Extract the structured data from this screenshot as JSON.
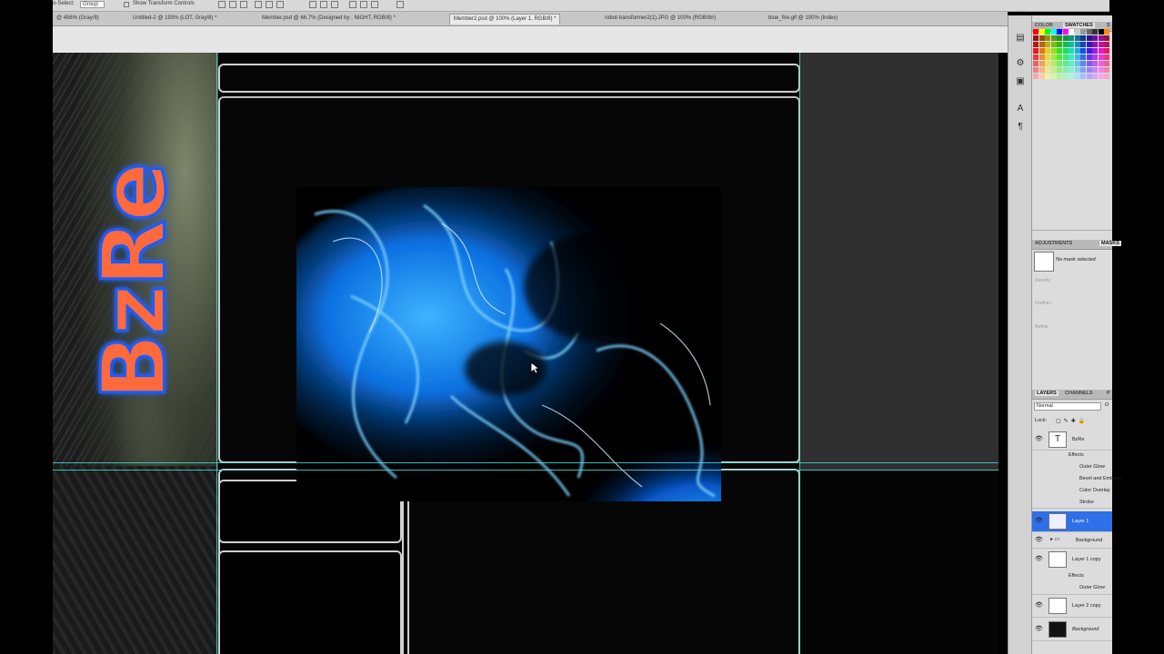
{
  "options_bar": {
    "auto_select_label": "o-Select:",
    "auto_select_value": "Group",
    "show_transform_controls": "Show Transform Controls"
  },
  "tabs": [
    {
      "label": "@ 456% (Gray/8)",
      "active": false
    },
    {
      "label": "Untitled-2 @ 193% (LOT, Gray/8) *",
      "active": false
    },
    {
      "label": "Member.psd @ 66.7% (Designed by . NIGHT, RGB/8) *",
      "active": false
    },
    {
      "label": "Member2.psd @ 100% (Layer 1, RGB/8) *",
      "active": true
    },
    {
      "label": "robot-transformer2(1).JPG @ 100% (RGB/8#)",
      "active": false
    },
    {
      "label": "blue_fire.gif @ 100% (Index)",
      "active": false
    }
  ],
  "canvas": {
    "logo_text": "BzRe"
  },
  "color_panel": {
    "tab_color": "COLOR",
    "tab_swatches": "SWATCHES",
    "tab_styles": "S"
  },
  "masks_panel": {
    "tab_adjustments": "ADJUSTMENTS",
    "tab_masks": "MASKS",
    "no_mask": "No mask selected",
    "density": "Density:",
    "feather": "Feather:",
    "refine": "Refine:"
  },
  "layers_panel": {
    "tab_layers": "LAYERS",
    "tab_channels": "CHANNELS",
    "tab_paths": "P",
    "blend_mode": "Normal",
    "opacity_label": "O",
    "lock_label": "Lock:",
    "layers": [
      {
        "name": "BzRe",
        "kind": "text",
        "visible": true,
        "selected": false
      },
      {
        "name": "Effects",
        "kind": "effects-header",
        "visible": false,
        "selected": false
      },
      {
        "name": "Outer Glow",
        "kind": "effect",
        "visible": true,
        "selected": false
      },
      {
        "name": "Bevel and Emboss",
        "kind": "effect",
        "visible": true,
        "selected": false
      },
      {
        "name": "Color Overlay",
        "kind": "effect",
        "visible": true,
        "selected": false
      },
      {
        "name": "Stroke",
        "kind": "effect",
        "visible": true,
        "selected": false
      },
      {
        "name": "Layer 1",
        "kind": "image",
        "visible": true,
        "selected": true
      },
      {
        "name": "Background",
        "kind": "group",
        "visible": true,
        "selected": false
      },
      {
        "name": "Layer 1 copy",
        "kind": "image",
        "visible": true,
        "selected": false
      },
      {
        "name": "Effects",
        "kind": "effects-header",
        "visible": false,
        "selected": false
      },
      {
        "name": "Outer Glow",
        "kind": "effect",
        "visible": true,
        "selected": false
      },
      {
        "name": "Layer 2 copy",
        "kind": "image",
        "visible": true,
        "selected": false
      },
      {
        "name": "Background",
        "kind": "background",
        "visible": true,
        "selected": false
      }
    ]
  },
  "colors": {
    "accent_selection": "#2f6fe8",
    "guide": "#43d9d0",
    "logo_fill": "#ff6a3d",
    "logo_stroke": "#1a5cff"
  }
}
